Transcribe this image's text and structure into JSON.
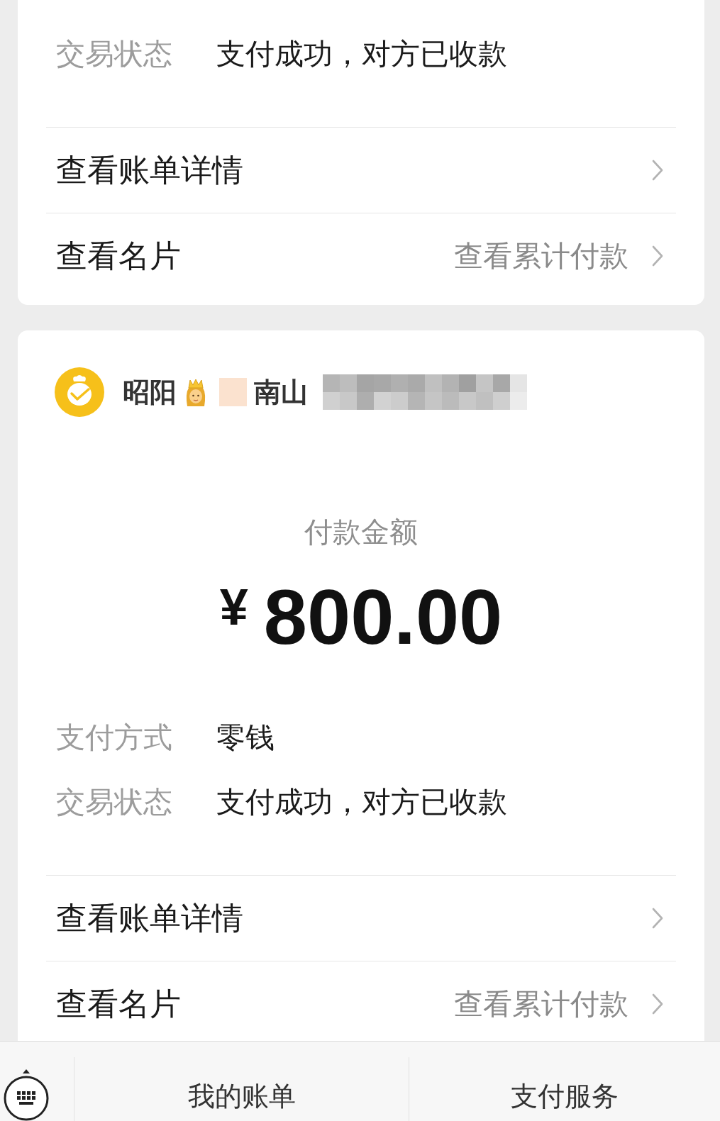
{
  "cards": [
    {
      "details": [
        {
          "label": "交易状态",
          "value": "支付成功，对方已收款"
        }
      ],
      "links": [
        {
          "label": "查看账单详情"
        },
        {
          "label": "查看名片",
          "hint": "查看累计付款"
        }
      ]
    },
    {
      "payee": {
        "name_before_emoji": "昭阳",
        "name_after_emoji": "南山"
      },
      "amount_label": "付款金额",
      "currency": "¥",
      "amount": "800.00",
      "details": [
        {
          "label": "支付方式",
          "value": "零钱"
        },
        {
          "label": "交易状态",
          "value": "支付成功，对方已收款"
        }
      ],
      "links": [
        {
          "label": "查看账单详情"
        },
        {
          "label": "查看名片",
          "hint": "查看累计付款"
        }
      ]
    }
  ],
  "bottom_bar": {
    "tabs": [
      {
        "label": "我的账单"
      },
      {
        "label": "支付服务"
      }
    ]
  }
}
